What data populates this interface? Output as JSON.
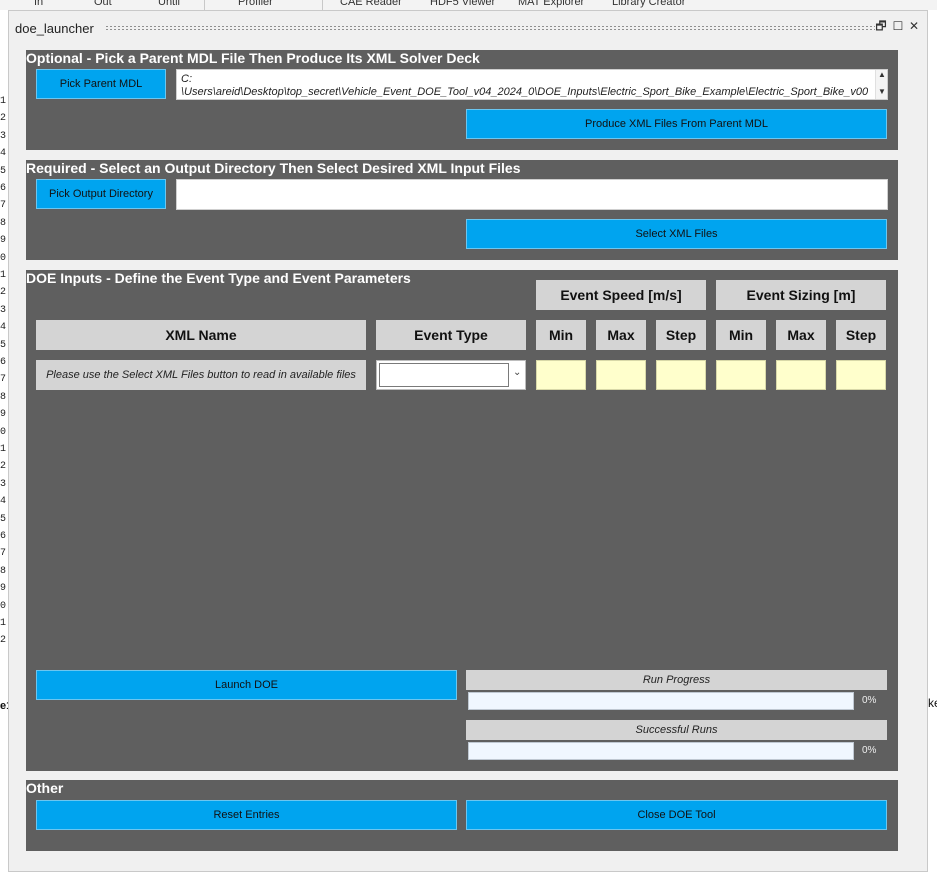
{
  "background": {
    "tabs": [
      "In",
      "Out",
      "Until",
      "Profiler",
      "CAE Reader",
      "HDF5 Viewer",
      "MAT Explorer",
      "Library Creator"
    ],
    "line_digits": [
      "1",
      "2",
      "3",
      "4",
      "5",
      "6",
      "7",
      "8",
      "9",
      "0",
      "1",
      "2",
      "3",
      "4",
      "5",
      "6",
      "7",
      "8",
      "9",
      "0",
      "1",
      "2",
      "3",
      "4",
      "5",
      "6",
      "7",
      "8",
      "9",
      "0",
      "1",
      "2"
    ],
    "right_fragment": "ke",
    "left_fragment": "e1"
  },
  "window": {
    "title": "doe_launcher",
    "restore_glyph": "🗗",
    "maximize_glyph": "☐",
    "close_glyph": "✕"
  },
  "optional": {
    "title": "Optional - Pick a Parent MDL File Then Produce Its XML Solver Deck",
    "pick_button": "Pick Parent MDL",
    "path_value": "C:\n\\Users\\areid\\Desktop\\top_secret\\Vehicle_Event_DOE_Tool_v04_2024_0\\DOE_Inputs\\Electric_Sport_Bike_Example\\Electric_Sport_Bike_v00",
    "produce_button": "Produce XML Files From Parent MDL"
  },
  "required": {
    "title": "Required - Select an Output Directory Then Select Desired XML Input Files",
    "pick_button": "Pick Output Directory",
    "output_dir_value": "",
    "select_button": "Select XML Files"
  },
  "doe": {
    "title": "DOE Inputs - Define the Event Type and Event Parameters",
    "speed_group": "Event Speed [m/s]",
    "sizing_group": "Event Sizing [m]",
    "col_xml_name": "XML Name",
    "col_event_type": "Event Type",
    "col_min": "Min",
    "col_max": "Max",
    "col_step": "Step",
    "row_placeholder": "Please use the Select XML Files button to read in available files",
    "event_type_value": "",
    "launch_button": "Launch DOE",
    "run_progress_label": "Run Progress",
    "run_progress_value": 0,
    "run_progress_text": "0%",
    "successful_runs_label": "Successful Runs",
    "successful_runs_value": 0,
    "successful_runs_text": "0%"
  },
  "other": {
    "title": "Other",
    "reset_button": "Reset Entries",
    "close_button": "Close DOE Tool"
  },
  "colors": {
    "accent_button": "#00a4ef",
    "panel_bg": "#5f5f5f",
    "input_cell": "#ffffcc"
  }
}
